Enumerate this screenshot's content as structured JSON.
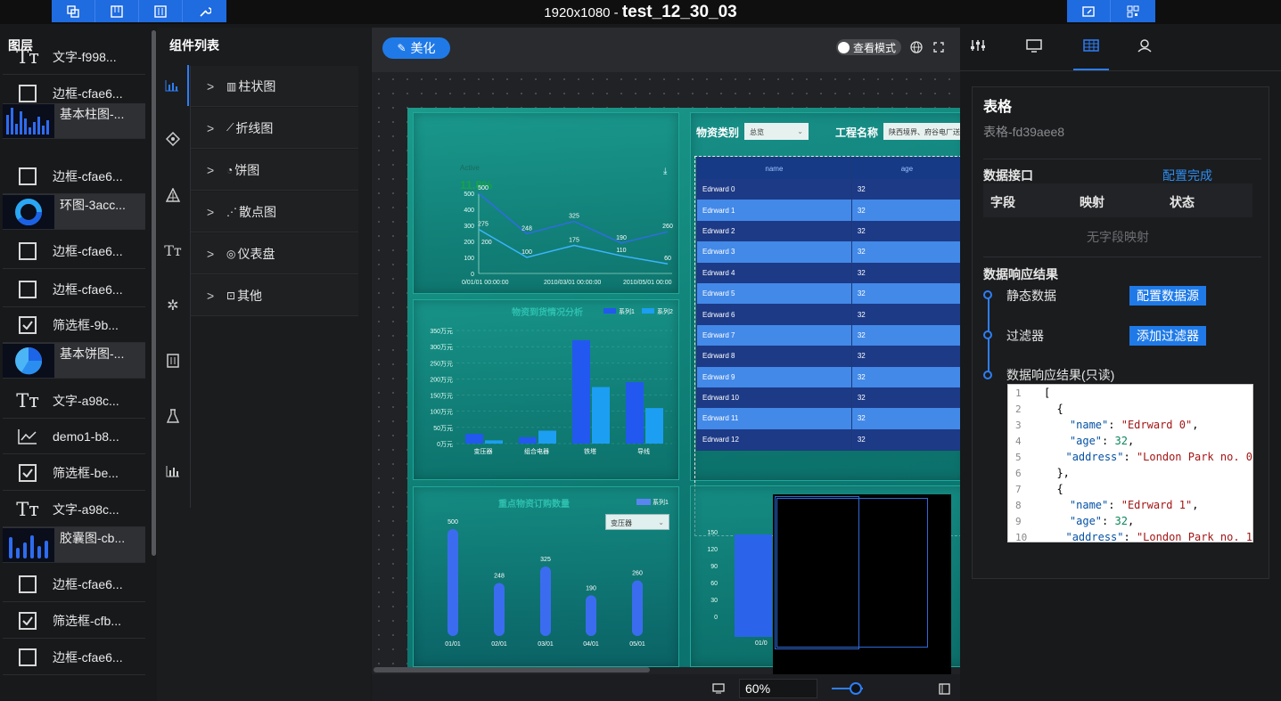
{
  "topbar": {
    "resolution": "1920x1080 - ",
    "project_name": "test_12_30_03",
    "left_tools": [
      "layers-icon",
      "layout-icon",
      "sliders-icon",
      "wrench-icon"
    ],
    "right_tools": [
      "image-edit-icon",
      "qr-icon"
    ]
  },
  "layers": {
    "title": "图层",
    "items": [
      {
        "icon": "text-icon",
        "label": "文字-f998..."
      },
      {
        "icon": "border-icon",
        "label": "边框-cfae6..."
      },
      {
        "icon": "bar-thumb",
        "label": "基本柱图-..."
      },
      {
        "icon": "border-icon",
        "label": "边框-cfae6..."
      },
      {
        "icon": "ring-thumb",
        "label": "环图-3acc..."
      },
      {
        "icon": "border-icon",
        "label": "边框-cfae6..."
      },
      {
        "icon": "border-icon",
        "label": "边框-cfae6..."
      },
      {
        "icon": "checkbox-icon",
        "label": "筛选框-9b..."
      },
      {
        "icon": "pie-thumb",
        "label": "基本饼图-..."
      },
      {
        "icon": "text-icon",
        "label": "文字-a98c..."
      },
      {
        "icon": "line-icon",
        "label": "demo1-b8..."
      },
      {
        "icon": "checkbox-icon",
        "label": "筛选框-be..."
      },
      {
        "icon": "text-icon",
        "label": "文字-a98c..."
      },
      {
        "icon": "capsule-thumb",
        "label": "胶囊图-cb..."
      },
      {
        "icon": "border-icon",
        "label": "边框-cfae6..."
      },
      {
        "icon": "checkbox-icon",
        "label": "筛选框-cfb..."
      },
      {
        "icon": "border-icon",
        "label": "边框-cfae6..."
      }
    ]
  },
  "components": {
    "title": "组件列表",
    "categories": [
      "柱状图",
      "折线图",
      "饼图",
      "散点图",
      "仪表盘",
      "其他"
    ]
  },
  "canvas": {
    "beautify_label": "美化",
    "view_mode_label": "查看模式",
    "zoom": "60%",
    "line_chart": {
      "legend": "Active",
      "percent": "11.8%",
      "y_ticks": [
        "500",
        "400",
        "300",
        "200",
        "100",
        "0"
      ],
      "x_ticks": [
        "0/01/01 00:00:00",
        "2010/03/01 00:00:00",
        "2010/05/01 00:00"
      ],
      "labels_a": [
        "500",
        "248",
        "325",
        "190",
        "260"
      ],
      "labels_b": [
        "275",
        "100",
        "175",
        "110",
        "60"
      ],
      "labels_c": [
        "200"
      ]
    },
    "bar_chart": {
      "title": "物资到货情况分析",
      "series": [
        "系列1",
        "系列2"
      ],
      "y_ticks": [
        "350万元",
        "300万元",
        "250万元",
        "200万元",
        "150万元",
        "100万元",
        "50万元",
        "0万元"
      ],
      "categories": [
        "变压器",
        "组合电器",
        "铁塔",
        "导线"
      ]
    },
    "capsule_chart": {
      "title": "重点物资订购数量",
      "legend": "系列1",
      "select": "变压器",
      "values": [
        "500",
        "248",
        "325",
        "190",
        "260"
      ],
      "categories": [
        "01/01",
        "02/01",
        "03/01",
        "04/01",
        "05/01"
      ]
    },
    "table_panel": {
      "filter1_label": "物资类别",
      "filter1_value": "总览",
      "filter2_label": "工程名称",
      "filter2_value": "陕西境界、府谷电厂送",
      "headers": [
        "name",
        "age"
      ],
      "rows": [
        {
          "name": "Edrward 0",
          "age": "32"
        },
        {
          "name": "Edrward 1",
          "age": "32"
        },
        {
          "name": "Edrward 2",
          "age": "32"
        },
        {
          "name": "Edrward 3",
          "age": "32"
        },
        {
          "name": "Edrward 4",
          "age": "32"
        },
        {
          "name": "Edrward 5",
          "age": "32"
        },
        {
          "name": "Edrward 6",
          "age": "32"
        },
        {
          "name": "Edrward 7",
          "age": "32"
        },
        {
          "name": "Edrward 8",
          "age": "32"
        },
        {
          "name": "Edrward 9",
          "age": "32"
        },
        {
          "name": "Edrward 10",
          "age": "32"
        },
        {
          "name": "Edrward 11",
          "age": "32"
        },
        {
          "name": "Edrward 12",
          "age": "32"
        }
      ]
    },
    "lower_right_ticks": [
      "150",
      "120",
      "90",
      "60",
      "30",
      "0"
    ],
    "lower_right_x": "01/0"
  },
  "right_panel": {
    "tabs": [
      "sliders-icon",
      "monitor-icon",
      "table-icon",
      "user-icon"
    ],
    "title": "表格",
    "id": "表格-fd39aee8",
    "interface_label": "数据接口",
    "config_done": "配置完成",
    "mapping_headers": [
      "字段",
      "映射",
      "状态"
    ],
    "no_mapping": "无字段映射",
    "response_label": "数据响应结果",
    "static_data": "静态数据",
    "config_source": "配置数据源",
    "filter": "过滤器",
    "add_filter": "添加过滤器",
    "readonly_result": "数据响应结果(只读)",
    "code_lines": [
      "[",
      "  {",
      "    \"name\": \"Edrward 0\",",
      "    \"age\": 32,",
      "    \"address\": \"London Park no. 0",
      "  },",
      "  {",
      "    \"name\": \"Edrward 1\",",
      "    \"age\": 32,",
      "    \"address\": \"London Park no. 1"
    ]
  }
}
